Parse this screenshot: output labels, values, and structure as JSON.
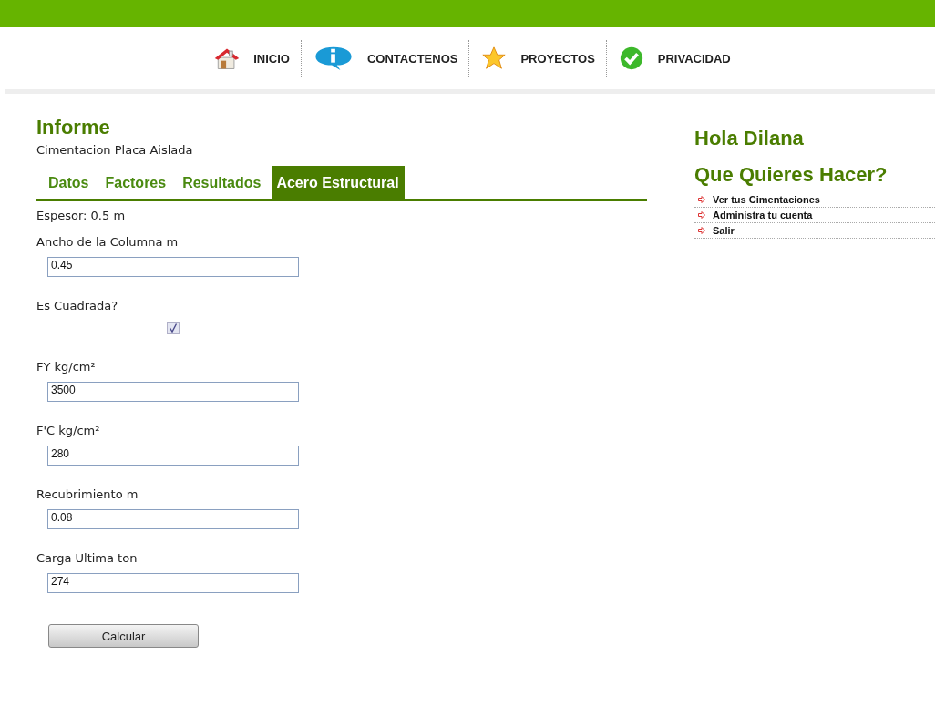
{
  "nav": [
    {
      "label": "INICIO",
      "kind": "house"
    },
    {
      "label": "CONTACTENOS",
      "kind": "info"
    },
    {
      "label": "PROYECTOS",
      "kind": "star"
    },
    {
      "label": "PRIVACIDAD",
      "kind": "check"
    }
  ],
  "main": {
    "title": "Informe",
    "subtitle": "Cimentacion Placa Aislada",
    "tabs": [
      {
        "label": "Datos",
        "selected": false
      },
      {
        "label": "Factores",
        "selected": false
      },
      {
        "label": "Resultados",
        "selected": false
      },
      {
        "label": "Acero Estructural",
        "selected": true
      }
    ],
    "info": "Espesor: 0.5 m",
    "fields": [
      {
        "kind": "text",
        "label": "Ancho de la Columna m",
        "value": "0.45"
      },
      {
        "kind": "checkbox",
        "label": "Es Cuadrada?",
        "checked": true
      },
      {
        "kind": "text",
        "label": "FY kg/cm²",
        "value": "3500"
      },
      {
        "kind": "text",
        "label": "F'C kg/cm²",
        "value": "280"
      },
      {
        "kind": "text",
        "label": "Recubrimiento m",
        "value": "0.08"
      },
      {
        "kind": "text",
        "label": "Carga Ultima ton",
        "value": "274"
      }
    ],
    "button": "Calcular"
  },
  "side": {
    "greeting": "Hola Dilana",
    "heading": "Que Quieres Hacer?",
    "links": [
      "Ver tus Cimentaciones",
      "Administra tu cuenta",
      "Salir"
    ]
  }
}
